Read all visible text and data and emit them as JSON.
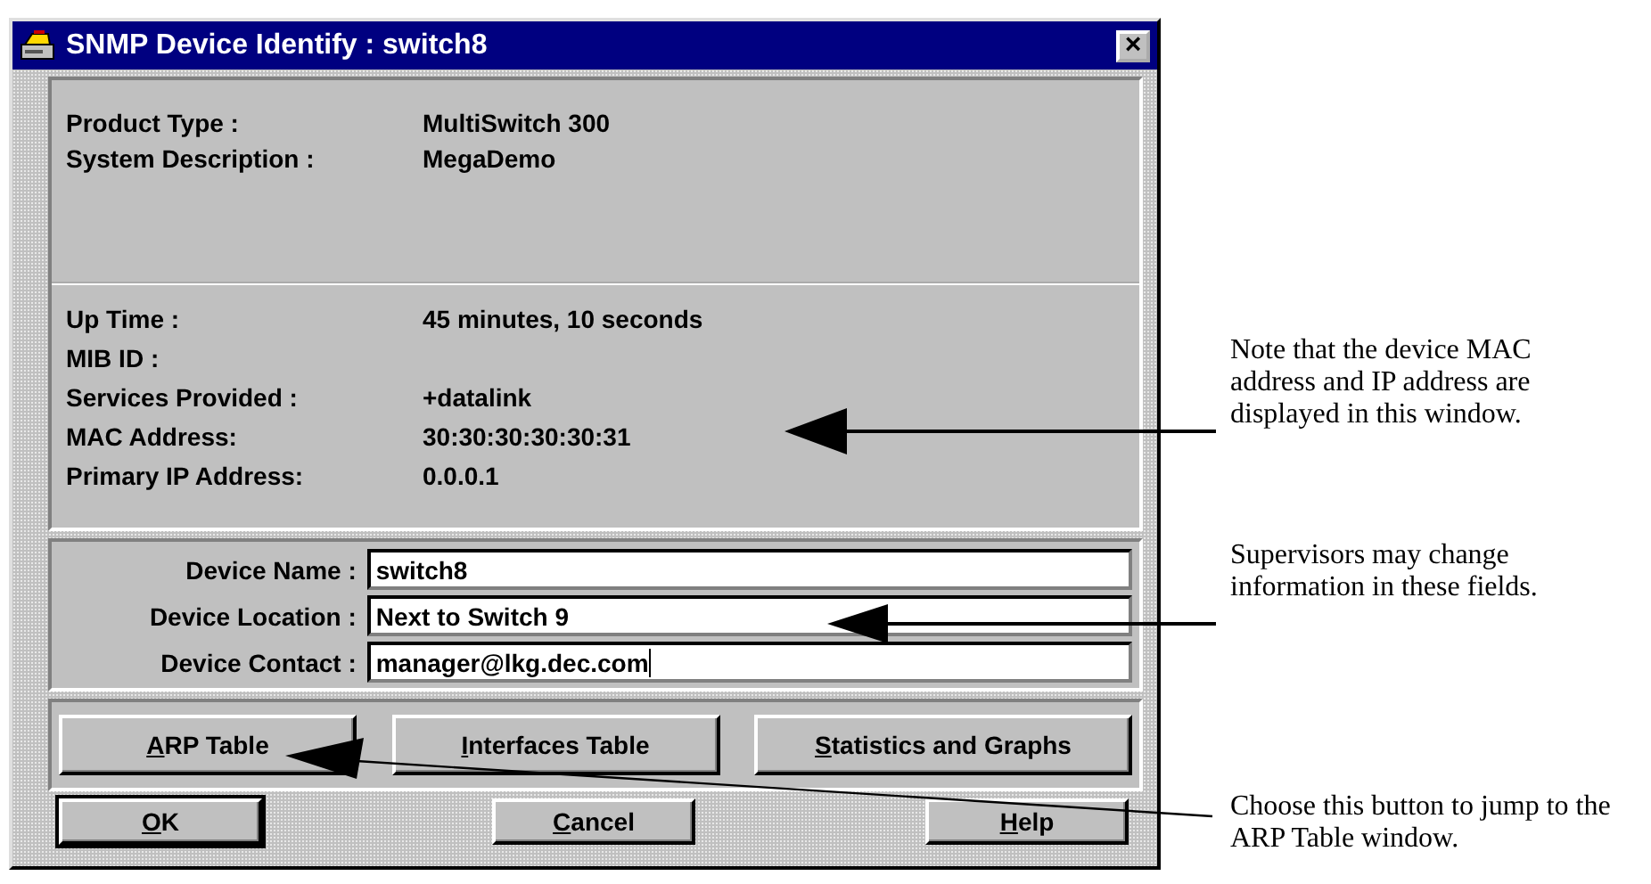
{
  "window": {
    "title": "SNMP Device Identify : switch8",
    "close": "×"
  },
  "info_sections": [
    {
      "rows": [
        {
          "label": "Product Type :",
          "value": "MultiSwitch 300"
        },
        {
          "label": "System Description :",
          "value": "MegaDemo"
        }
      ]
    },
    {
      "rows": [
        {
          "label": "Up Time :",
          "value": "45 minutes, 10 seconds"
        },
        {
          "label": "MIB ID :"
        },
        {
          "label": "Services Provided :",
          "value": "+datalink"
        },
        {
          "label": "MAC Address:",
          "value": "30:30:30:30:30:31"
        },
        {
          "label": "Primary IP Address:",
          "value": "0.0.0.1"
        }
      ]
    }
  ],
  "fields": [
    {
      "label": "Device Name :",
      "value": "switch8",
      "focused": false
    },
    {
      "label": "Device Location :",
      "value": "Next to Switch 9",
      "focused": false
    },
    {
      "label": "Device Contact :",
      "value": "manager@lkg.dec.com",
      "focused": true
    }
  ],
  "table_buttons": [
    {
      "accel": "A",
      "rest": "RP Table"
    },
    {
      "accel": "I",
      "rest": "nterfaces Table"
    },
    {
      "accel": "S",
      "rest": "tatistics and Graphs"
    }
  ],
  "dialog_buttons": [
    {
      "accel": "O",
      "rest": "K",
      "default": true
    },
    {
      "accel": "C",
      "rest": "ancel",
      "default": false
    },
    {
      "accel": "H",
      "rest": "elp",
      "default": false
    }
  ],
  "callouts": [
    {
      "text": "Note that the device MAC address and IP address are displayed in this window."
    },
    {
      "text": "Supervisors may change information in these fields."
    },
    {
      "text": "Choose this button to jump to the ARP Table window."
    }
  ]
}
